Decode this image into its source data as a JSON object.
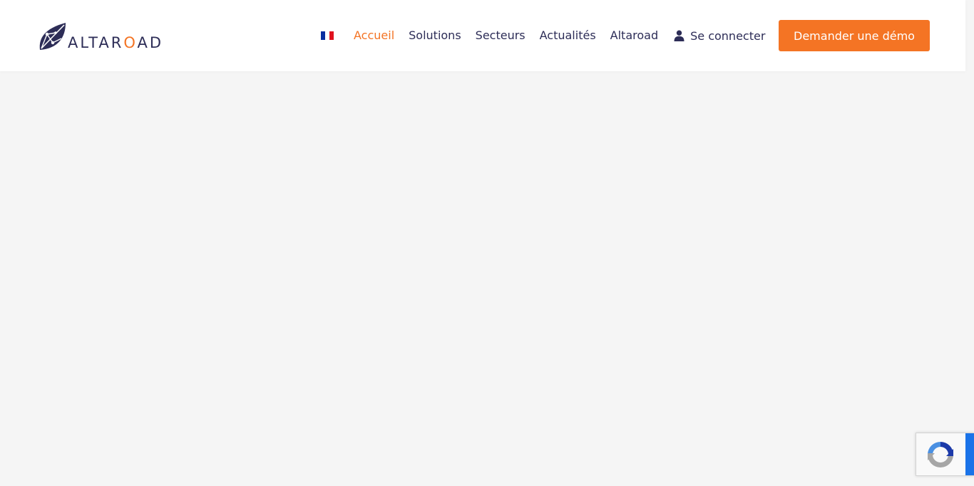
{
  "brand": {
    "name_prefix": "ALTAR",
    "name_o": "O",
    "name_suffix": "AD",
    "logo_icon": "altaroad-leaf-icon"
  },
  "colors": {
    "brand_navy": "#2d2d57",
    "accent_orange": "#f47424",
    "background": "#f5f5f5",
    "header_bg": "#ffffff"
  },
  "nav": {
    "language_flag": "france-flag-icon",
    "items": [
      {
        "label": "Accueil",
        "active": true
      },
      {
        "label": "Solutions",
        "active": false
      },
      {
        "label": "Secteurs",
        "active": false
      },
      {
        "label": "Actualités",
        "active": false
      },
      {
        "label": "Altaroad",
        "active": false
      }
    ],
    "login_label": "Se connecter",
    "login_icon": "user-icon",
    "cta_label": "Demander une démo"
  },
  "recaptcha": {
    "icon": "recaptcha-icon"
  }
}
